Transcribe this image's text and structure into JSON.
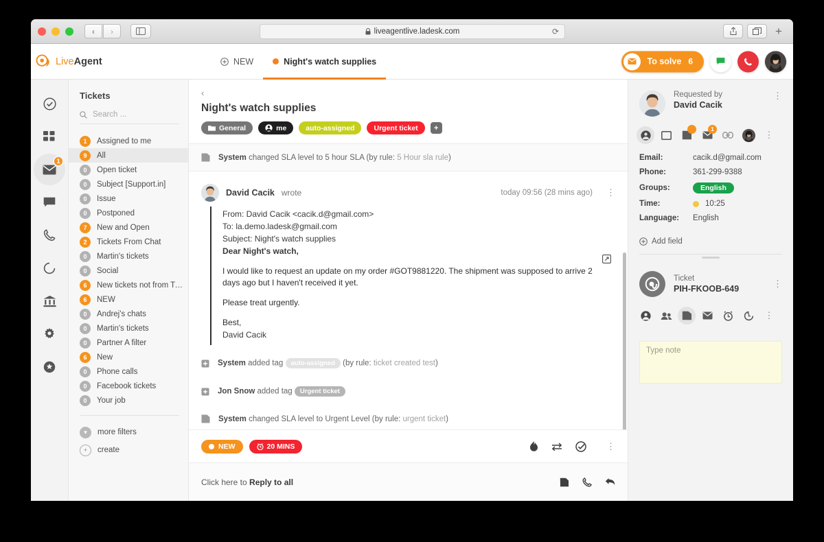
{
  "browser": {
    "url": "liveagentlive.ladesk.com",
    "lock_icon": "lock-icon",
    "back_icon": "‹",
    "forward_icon": "›",
    "reload_icon": "⟳",
    "share_icon": "share-icon",
    "tabs_icon": "tabs-icon",
    "newtab_icon": "+"
  },
  "app": {
    "logo_pre": "Live",
    "logo_post": "Agent",
    "tabs": [
      {
        "label": "NEW",
        "icon": "plus-circle-icon",
        "active": false
      },
      {
        "label": "Night's watch supplies",
        "icon": "orange-dot-icon",
        "active": true
      }
    ],
    "header_actions": {
      "solve_label": "To solve",
      "solve_count": "6",
      "solve_icon": "envelope-icon",
      "chat_icon": "chat-icon",
      "phone_icon": "phone-icon",
      "avatar": "user-avatar"
    }
  },
  "rail": [
    {
      "name": "check-circle-icon",
      "badge": ""
    },
    {
      "name": "dashboard-grid-icon",
      "badge": ""
    },
    {
      "name": "envelope-icon",
      "badge": "1",
      "active": true
    },
    {
      "name": "chat-bubble-icon",
      "badge": ""
    },
    {
      "name": "phone-icon",
      "badge": ""
    },
    {
      "name": "refresh-icon",
      "badge": ""
    },
    {
      "name": "bank-icon",
      "badge": ""
    },
    {
      "name": "gear-icon",
      "badge": ""
    },
    {
      "name": "star-circle-icon",
      "badge": ""
    }
  ],
  "filters": {
    "title": "Tickets",
    "search_placeholder": "Search ...",
    "search_value": "",
    "search_icon": "search-icon",
    "items": [
      {
        "count": "1",
        "label": "Assigned to me",
        "highlight": true,
        "selected": false
      },
      {
        "count": "9",
        "label": "All",
        "highlight": true,
        "selected": true
      },
      {
        "count": "0",
        "label": "Open ticket",
        "highlight": false,
        "selected": false
      },
      {
        "count": "0",
        "label": "Subject [Support.in]",
        "highlight": false,
        "selected": false
      },
      {
        "count": "0",
        "label": "Issue",
        "highlight": false,
        "selected": false
      },
      {
        "count": "0",
        "label": "Postponed",
        "highlight": false,
        "selected": false
      },
      {
        "count": "7",
        "label": "New and Open",
        "highlight": true,
        "selected": false
      },
      {
        "count": "2",
        "label": "Tickets From Chat",
        "highlight": true,
        "selected": false
      },
      {
        "count": "0",
        "label": "Martin's tickets",
        "highlight": false,
        "selected": false
      },
      {
        "count": "0",
        "label": "Social",
        "highlight": false,
        "selected": false
      },
      {
        "count": "6",
        "label": "New tickets not from Twi…",
        "highlight": true,
        "selected": false
      },
      {
        "count": "6",
        "label": "NEW",
        "highlight": true,
        "selected": false
      },
      {
        "count": "0",
        "label": "Andrej's chats",
        "highlight": false,
        "selected": false
      },
      {
        "count": "0",
        "label": "Martin's tickets",
        "highlight": false,
        "selected": false
      },
      {
        "count": "0",
        "label": "Partner A filter",
        "highlight": false,
        "selected": false
      },
      {
        "count": "6",
        "label": "New",
        "highlight": true,
        "selected": false
      },
      {
        "count": "0",
        "label": "Phone calls",
        "highlight": false,
        "selected": false
      },
      {
        "count": "0",
        "label": "Facebook tickets",
        "highlight": false,
        "selected": false
      },
      {
        "count": "0",
        "label": "Your job",
        "highlight": false,
        "selected": false
      }
    ],
    "more_filters": "more filters",
    "create": "create"
  },
  "ticket": {
    "back_icon": "chevron-left-icon",
    "title": "Night's watch supplies",
    "tags": [
      {
        "label": "General",
        "style": "general",
        "icon": "folder-icon"
      },
      {
        "label": "me",
        "style": "me",
        "icon": "person-icon"
      },
      {
        "label": "auto-assigned",
        "style": "auto",
        "icon": ""
      },
      {
        "label": "Urgent ticket",
        "style": "urgent",
        "icon": ""
      }
    ],
    "tag_add": "+",
    "events_top": {
      "actor": "System",
      "text": "changed SLA level to 5 hour SLA (by rule: ",
      "rule": "5 Hour sla rule",
      "text_end": ")",
      "icon": "note-icon"
    },
    "message": {
      "author": "David Cacik",
      "verb": "wrote",
      "time": "today 09:56 (28 mins ago)",
      "kebab": "⋮",
      "popout_icon": "open-external-icon",
      "from": "From: David Cacik <cacik.d@gmail.com>",
      "to": "To: la.demo.ladesk@gmail.com",
      "subject": "Subject: Night's watch supplies",
      "greeting": "Dear Night's watch,",
      "paragraph1": "I would like to request an update on my order #GOT9881220. The shipment was supposed to arrive 2 days ago but I haven't received it yet.",
      "paragraph2": "Please treat urgently.",
      "signoff": "Best,",
      "signature": "David Cacik"
    },
    "events_bottom": [
      {
        "actor": "System",
        "text": "added tag",
        "tag": "auto-assigned",
        "tag_style": "light",
        "suffix": "(by rule: ",
        "rule": "ticket created test",
        "suffix_end": ")",
        "icon": "tag-icon"
      },
      {
        "actor": "Jon Snow",
        "text": "added tag",
        "tag": "Urgent ticket",
        "tag_style": "grey",
        "suffix": "",
        "rule": "",
        "suffix_end": "",
        "icon": "tag-icon"
      },
      {
        "actor": "System",
        "text": "changed SLA level to Urgent Level (by rule: ",
        "tag": "",
        "tag_style": "",
        "suffix": "",
        "rule": "urgent ticket",
        "suffix_end": ")",
        "icon": "note-icon"
      }
    ],
    "status": {
      "state_label": "NEW",
      "timer_label": "20 MINS",
      "timer_icon": "alarm-icon",
      "actions": [
        "flame-icon",
        "transfer-icon",
        "resolve-icon",
        "kebab-icon"
      ]
    },
    "reply": {
      "prefix": "Click here to ",
      "bold": "Reply to all",
      "icons": [
        "note-icon",
        "phone-icon",
        "reply-arrow-icon"
      ]
    }
  },
  "contact": {
    "requested_label": "Requested by",
    "name": "David Cacik",
    "kebab": "⋮",
    "tab_icons": [
      {
        "name": "person-icon",
        "badge": "",
        "active": true
      },
      {
        "name": "window-icon",
        "badge": "",
        "active": false
      },
      {
        "name": "note-icon",
        "badge": "•",
        "active": false
      },
      {
        "name": "envelope-icon",
        "badge": "1",
        "active": false
      },
      {
        "name": "link-icon",
        "badge": "",
        "active": false
      },
      {
        "name": "avatar-icon",
        "badge": "",
        "active": false
      },
      {
        "name": "kebab-icon",
        "badge": "",
        "active": false
      }
    ],
    "fields": [
      {
        "key": "Email:",
        "value": "cacik.d@gmail.com",
        "type": "text"
      },
      {
        "key": "Phone:",
        "value": "361-299-9388",
        "type": "text"
      },
      {
        "key": "Groups:",
        "value": "English",
        "type": "pill"
      },
      {
        "key": "Time:",
        "value": "10:25",
        "type": "time"
      },
      {
        "key": "Language:",
        "value": "English",
        "type": "text"
      }
    ],
    "add_field": "Add field",
    "add_field_icon": "plus-circle-icon"
  },
  "ticket_panel": {
    "label": "Ticket",
    "id": "PIH-FKOOB-649",
    "avatar_icon": "at-icon",
    "kebab": "⋮",
    "tab_icons": [
      {
        "name": "person-icon",
        "active": false
      },
      {
        "name": "people-icon",
        "active": false
      },
      {
        "name": "note-icon",
        "active": true
      },
      {
        "name": "envelope-icon",
        "active": false
      },
      {
        "name": "alarm-icon",
        "active": false
      },
      {
        "name": "history-icon",
        "active": false
      },
      {
        "name": "kebab-icon",
        "active": false
      }
    ],
    "note_placeholder": "Type note",
    "note_value": ""
  },
  "colors": {
    "accent_orange": "#f5931e",
    "urgent_red": "#f8232f",
    "auto_yellow": "#c4cf1d",
    "group_green": "#19a24a",
    "phone_red": "#e8343c"
  }
}
